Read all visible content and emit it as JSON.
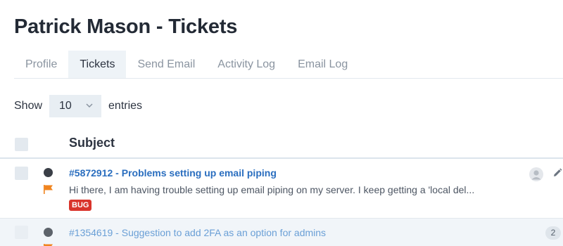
{
  "page": {
    "title": "Patrick Mason - Tickets"
  },
  "tabs": [
    {
      "label": "Profile",
      "active": false
    },
    {
      "label": "Tickets",
      "active": true
    },
    {
      "label": "Send Email",
      "active": false
    },
    {
      "label": "Activity Log",
      "active": false
    },
    {
      "label": "Email Log",
      "active": false
    }
  ],
  "entries": {
    "show_label": "Show",
    "value": "10",
    "entries_label": "entries"
  },
  "table": {
    "columns": {
      "subject": "Subject"
    },
    "rows": [
      {
        "subject": "#5872912 - Problems setting up email piping",
        "preview": "Hi there, I am having trouble setting up email piping on my server. I keep getting a 'local del...",
        "tag": "BUG",
        "status_icon": "status-dot-icon",
        "priority_icon": "flag-icon",
        "assignee_icon": "avatar-icon",
        "action_icon": "pencil-icon"
      },
      {
        "subject": "#1354619 - Suggestion to add 2FA as an option for admins",
        "count": "2",
        "status_icon": "status-dot-icon",
        "priority_icon": "flag-icon"
      }
    ]
  },
  "colors": {
    "link": "#2a6ebf",
    "link_faded": "#6a9fd6",
    "flag": "#f0841e",
    "bug_badge": "#d9342b",
    "tab_active_bg": "#eef3f7",
    "status_dot": "#3a3f47"
  }
}
